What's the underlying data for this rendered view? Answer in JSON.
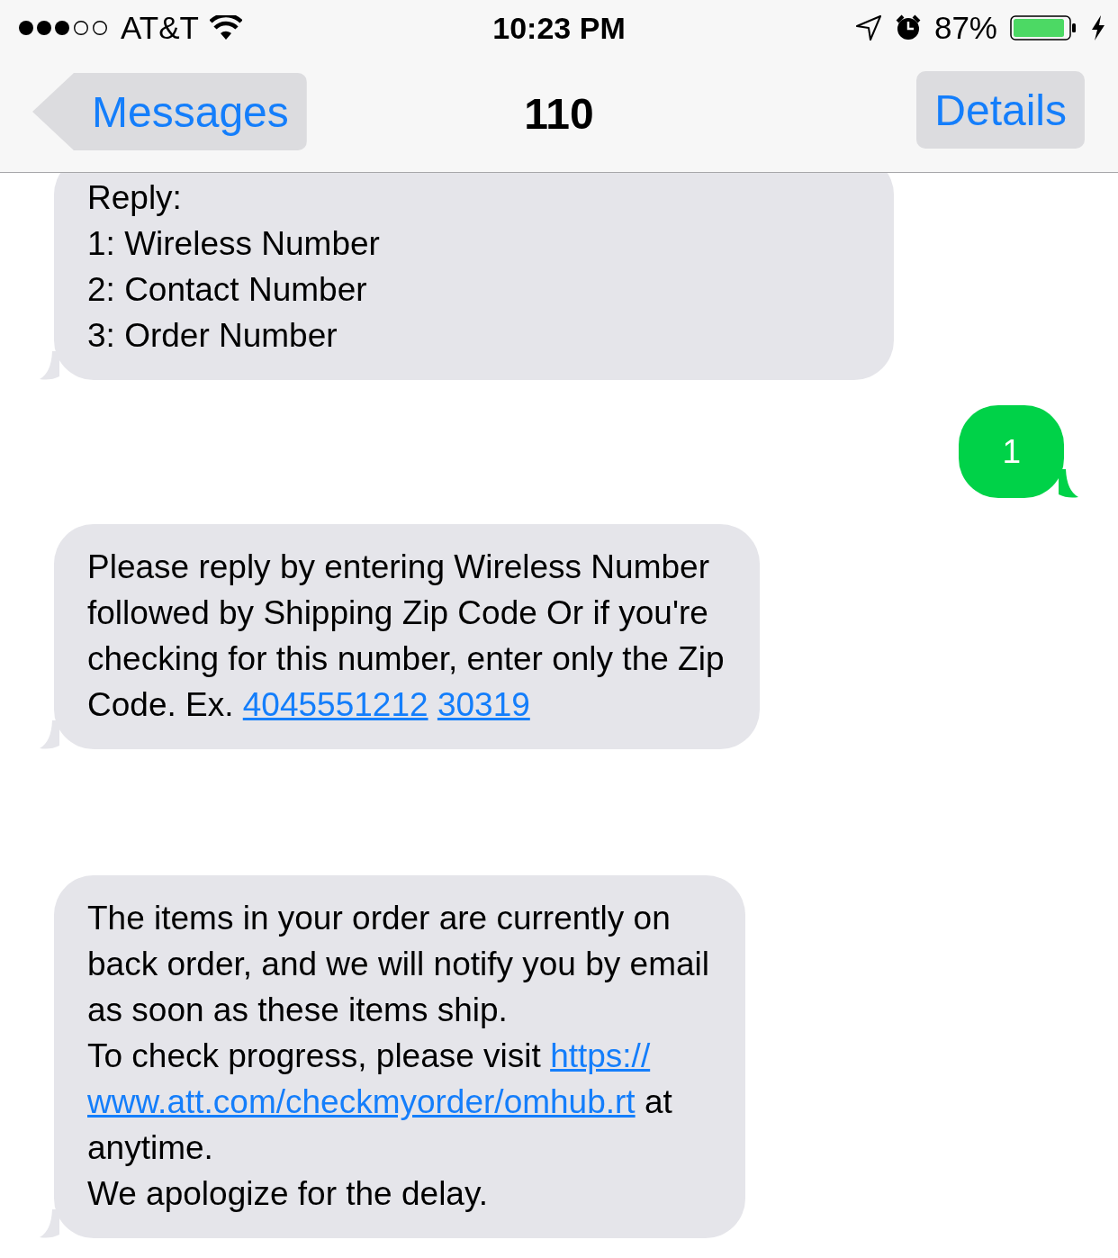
{
  "status_bar": {
    "carrier": "AT&T",
    "time": "10:23 PM",
    "battery": "87%"
  },
  "nav": {
    "back": "Messages",
    "title": "110",
    "action": "Details"
  },
  "messages": [
    {
      "kind": "received",
      "lines": [
        [
          {
            "kind": "text",
            "text": "Reply:"
          }
        ],
        [
          {
            "kind": "text",
            "text": "1: Wireless Number"
          }
        ],
        [
          {
            "kind": "text",
            "text": "2: Contact Number"
          }
        ],
        [
          {
            "kind": "text",
            "text": "3: Order Number"
          }
        ]
      ]
    },
    {
      "kind": "sent",
      "lines": [
        [
          {
            "kind": "text",
            "text": "1"
          }
        ]
      ]
    },
    {
      "kind": "received",
      "lines": [
        [
          {
            "kind": "text",
            "text": "Please reply by entering Wireless Number"
          }
        ],
        [
          {
            "kind": "text",
            "text": "followed by Shipping Zip Code Or if you're"
          }
        ],
        [
          {
            "kind": "text",
            "text": "checking for this number, enter only the Zip"
          }
        ],
        [
          {
            "kind": "text",
            "text": "Code. Ex. "
          },
          {
            "kind": "link",
            "text": "4045551212"
          },
          {
            "kind": "link",
            "text": "30319"
          }
        ]
      ]
    },
    {
      "kind": "received",
      "lines": [
        [
          {
            "kind": "text",
            "text": "The items in your order are currently on"
          }
        ],
        [
          {
            "kind": "text",
            "text": "back order, and we will notify you by email"
          }
        ],
        [
          {
            "kind": "text",
            "text": "as soon as these items ship."
          }
        ],
        [
          {
            "kind": "text",
            "text": "To check progress, please visit "
          },
          {
            "kind": "link",
            "text": "https://"
          }
        ],
        [
          {
            "kind": "link",
            "text": "www.att.com/checkmyorder/omhub.rt"
          },
          {
            "kind": "text",
            "text": " at"
          }
        ],
        [
          {
            "kind": "text",
            "text": "anytime."
          }
        ],
        [
          {
            "kind": "text",
            "text": "We apologize for the delay."
          }
        ]
      ]
    }
  ]
}
